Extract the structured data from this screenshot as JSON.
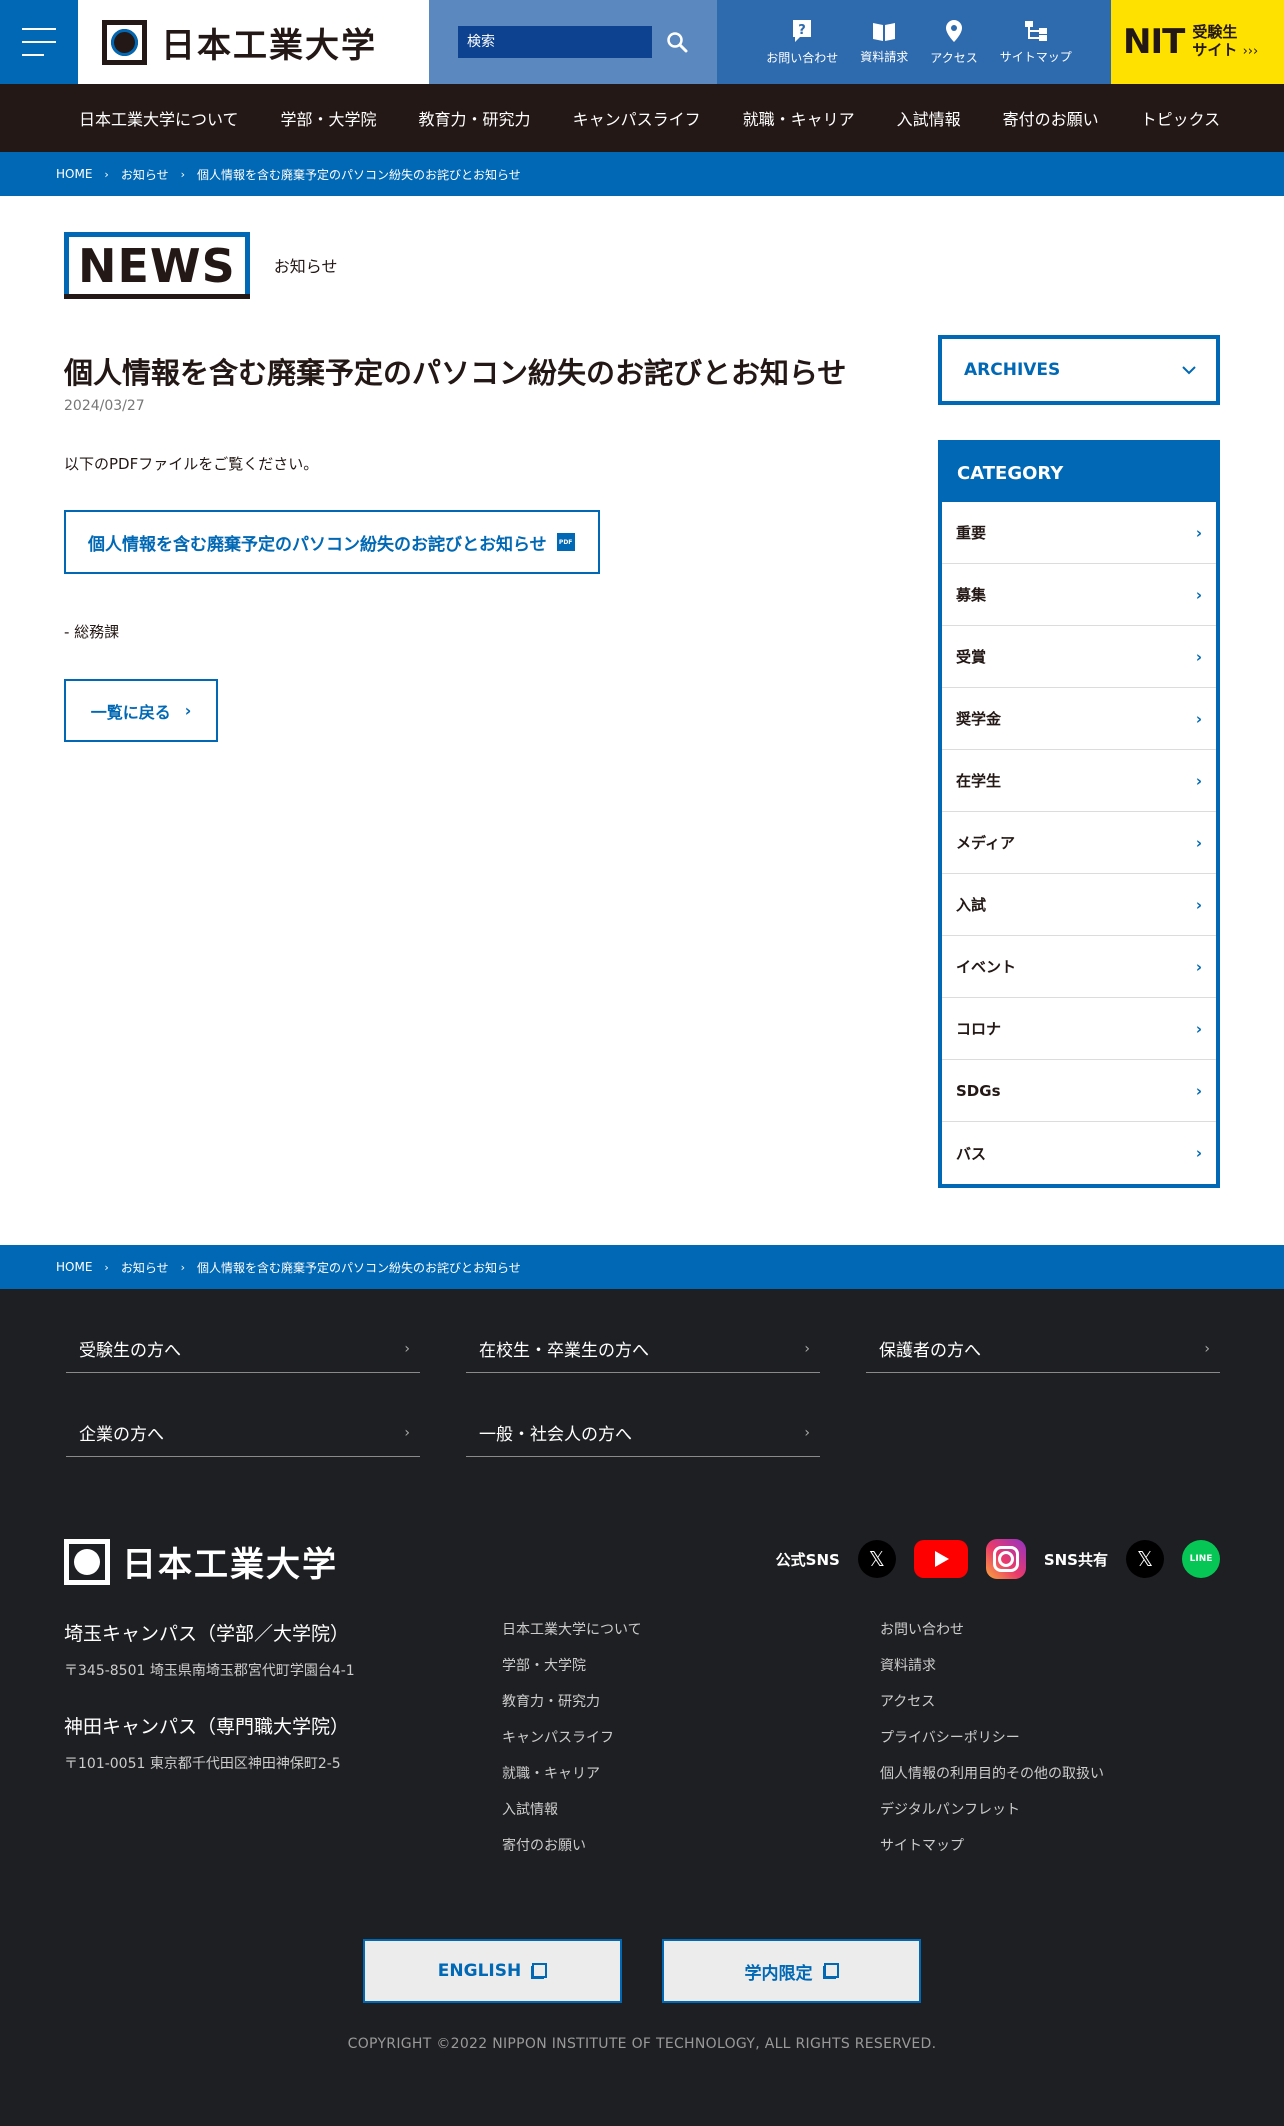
{
  "header": {
    "logo_text": "日本工業大学",
    "search_placeholder": "検索",
    "utility": [
      {
        "label": "お問い合わせ",
        "icon": "question-icon"
      },
      {
        "label": "資料請求",
        "icon": "book-icon"
      },
      {
        "label": "アクセス",
        "icon": "map-pin-icon"
      },
      {
        "label": "サイトマップ",
        "icon": "sitemap-icon"
      }
    ],
    "nit_logo": "NIT",
    "nit_line1": "受験生",
    "nit_line2": "サイト",
    "nit_arrows": "›››"
  },
  "gnav": [
    "日本工業大学について",
    "学部・大学院",
    "教育力・研究力",
    "キャンパスライフ",
    "就職・キャリア",
    "入試情報",
    "寄付のお願い",
    "トピックス"
  ],
  "breadcrumb": {
    "home": "HOME",
    "section": "お知らせ",
    "current": "個人情報を含む廃棄予定のパソコン紛失のお詫びとお知らせ"
  },
  "page": {
    "news_label": "NEWS",
    "news_sub": "お知らせ"
  },
  "article": {
    "title": "個人情報を含む廃棄予定のパソコン紛失のお詫びとお知らせ",
    "date": "2024/03/27",
    "body": "以下のPDFファイルをご覧ください。",
    "pdf_link": "個人情報を含む廃棄予定のパソコン紛失のお詫びとお知らせ",
    "pdf_icon_text": "PDF",
    "department": "- 総務課",
    "back_label": "一覧に戻る"
  },
  "sidebar": {
    "archives": "ARCHIVES",
    "category_title": "CATEGORY",
    "categories": [
      "重要",
      "募集",
      "受賞",
      "奨学金",
      "在学生",
      "メディア",
      "入試",
      "イベント",
      "コロナ",
      "SDGs",
      "バス"
    ]
  },
  "footer": {
    "targets": [
      "受験生の方へ",
      "在校生・卒業生の方へ",
      "保護者の方へ",
      "企業の方へ",
      "一般・社会人の方へ"
    ],
    "logo_text": "日本工業大学",
    "sns_official": "公式SNS",
    "sns_share": "SNS共有",
    "line_label": "LINE",
    "campus1_name": "埼玉キャンパス（学部／大学院）",
    "campus1_addr": "〒345-8501 埼玉県南埼玉郡宮代町学園台4-1",
    "campus2_name": "神田キャンパス（専門職大学院）",
    "campus2_addr": "〒101-0051 東京都千代田区神田神保町2-5",
    "links_col1": [
      "日本工業大学について",
      "学部・大学院",
      "教育力・研究力",
      "キャンパスライフ",
      "就職・キャリア",
      "入試情報",
      "寄付のお願い"
    ],
    "links_col2": [
      "お問い合わせ",
      "資料請求",
      "アクセス",
      "プライバシーポリシー",
      "個人情報の利用目的その他の取扱い",
      "デジタルパンフレット",
      "サイトマップ"
    ],
    "english_button": "ENGLISH",
    "internal_button": "学内限定",
    "copyright": "COPYRIGHT ©2022 NIPPON INSTITUTE OF TECHNOLOGY, ALL RIGHTS RESERVED."
  },
  "colors": {
    "brand_blue": "#0068b4",
    "dark": "#231815",
    "yellow": "#ffe100",
    "footer_bg": "#1e1f22"
  }
}
